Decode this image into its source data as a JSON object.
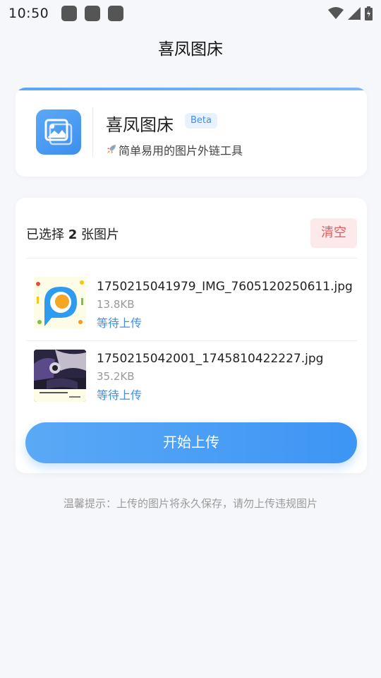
{
  "status_bar": {
    "time": "10:50"
  },
  "app": {
    "title": "喜凤图床"
  },
  "header_card": {
    "brand_name": "喜凤图床",
    "badge": "Beta",
    "tagline": "简单易用的图片外链工具",
    "accent_color": "#4a9af5"
  },
  "selection": {
    "prefix": "已选择 ",
    "count": "2",
    "suffix": " 张图片",
    "clear_label": "清空"
  },
  "files": [
    {
      "name": "1750215041979_IMG_7605120250611.jpg",
      "size": "13.8KB",
      "status": "等待上传",
      "thumb_icon": "p-logo-icon"
    },
    {
      "name": "1750215042001_1745810422227.jpg",
      "size": "35.2KB",
      "status": "等待上传",
      "thumb_icon": "photo-thumbnail"
    }
  ],
  "upload_button_label": "开始上传",
  "tip": "温馨提示：上传的图片将永久保存，请勿上传违规图片",
  "colors": {
    "primary": "#3d95f4",
    "danger": "#e25a5f",
    "danger_bg": "#fde9ea",
    "background": "#f6f7fa"
  }
}
